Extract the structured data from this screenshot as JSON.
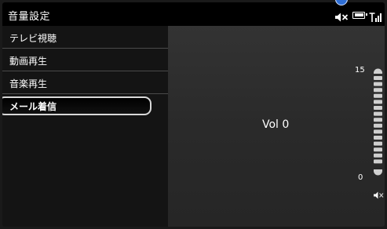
{
  "header": {
    "title": "音量設定",
    "status_icons": [
      "mute-icon",
      "battery-icon",
      "signal-icon"
    ]
  },
  "menu": {
    "items": [
      {
        "label": "テレビ視聴"
      },
      {
        "label": "動画再生"
      },
      {
        "label": "音楽再生"
      },
      {
        "label": "メール着信",
        "selected": true
      }
    ]
  },
  "volume": {
    "readout": "Vol 0",
    "max_label": "15",
    "min_label": "0",
    "level": 0,
    "max_level": 15,
    "icon": "speaker-mute-icon"
  },
  "colors": {
    "accent_cursor": "#2f6fd6",
    "selected_border": "#d8d8d8",
    "divider": "#4a4a4a"
  }
}
